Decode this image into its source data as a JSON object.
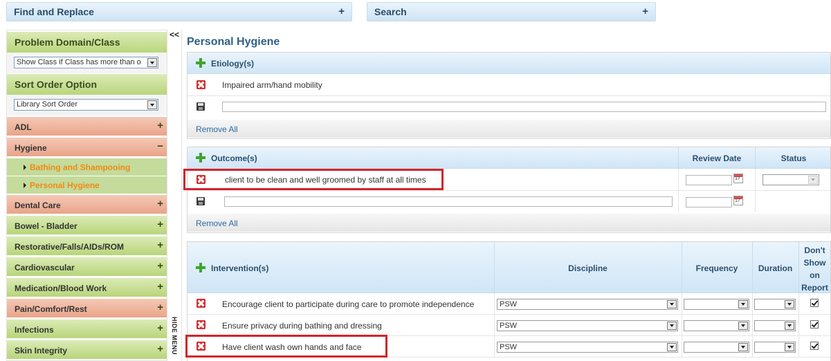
{
  "top": {
    "find_replace": "Find and Replace",
    "search": "Search",
    "expand_icon": "plus-icon"
  },
  "sidebar": {
    "problem_domain_title": "Problem Domain/Class",
    "problem_domain_select": "Show Class if Class has more than o",
    "sort_order_title": "Sort Order Option",
    "sort_order_select": "Library Sort Order",
    "categories": [
      {
        "label": "ADL",
        "state": "+",
        "color": "red"
      },
      {
        "label": "Hygiene",
        "state": "−",
        "color": "red"
      },
      {
        "label": "Dental Care",
        "state": "+",
        "color": "red"
      },
      {
        "label": "Bowel - Bladder",
        "state": "+",
        "color": "green"
      },
      {
        "label": "Restorative/Falls/AIDs/ROM",
        "state": "+",
        "color": "green"
      },
      {
        "label": "Cardiovascular",
        "state": "+",
        "color": "green"
      },
      {
        "label": "Medication/Blood Work",
        "state": "+",
        "color": "green"
      },
      {
        "label": "Pain/Comfort/Rest",
        "state": "+",
        "color": "red"
      },
      {
        "label": "Infections",
        "state": "+",
        "color": "green"
      },
      {
        "label": "Skin Integrity",
        "state": "+",
        "color": "green"
      }
    ],
    "subitems": [
      "Bathing and Shampooing",
      "Personal Hygiene"
    ],
    "collapse_label": "<<",
    "hide_menu": "HIDE MENU"
  },
  "main": {
    "title": "Personal Hygiene",
    "etiology": {
      "header": "Etiology(s)",
      "items": [
        "Impaired arm/hand mobility"
      ],
      "new_value": "",
      "remove_all": "Remove All"
    },
    "outcome": {
      "header": "Outcome(s)",
      "col_review_date": "Review Date",
      "col_status": "Status",
      "items": [
        {
          "text": "client to be clean and well groomed by staff at all times",
          "review_date": "",
          "status": ""
        }
      ],
      "new_value": "",
      "remove_all": "Remove All"
    },
    "intervention": {
      "header": "Intervention(s)",
      "col_discipline": "Discipline",
      "col_frequency": "Frequency",
      "col_duration": "Duration",
      "col_dont_show": [
        "Don't",
        "Show",
        "on",
        "Report"
      ],
      "items": [
        {
          "text": "Encourage client to participate during care to promote independence",
          "discipline": "PSW",
          "frequency": "",
          "duration": "",
          "dont_show": true
        },
        {
          "text": "Ensure privacy during bathing and dressing",
          "discipline": "PSW",
          "frequency": "",
          "duration": "",
          "dont_show": true
        },
        {
          "text": "Have client wash own hands and face",
          "discipline": "PSW",
          "frequency": "",
          "duration": "",
          "dont_show": true
        }
      ]
    }
  },
  "colors": {
    "accent_red": "#d2232a",
    "link_blue": "#2c6aa0",
    "title_blue": "#2d6087",
    "sub_orange": "#f18a12"
  }
}
